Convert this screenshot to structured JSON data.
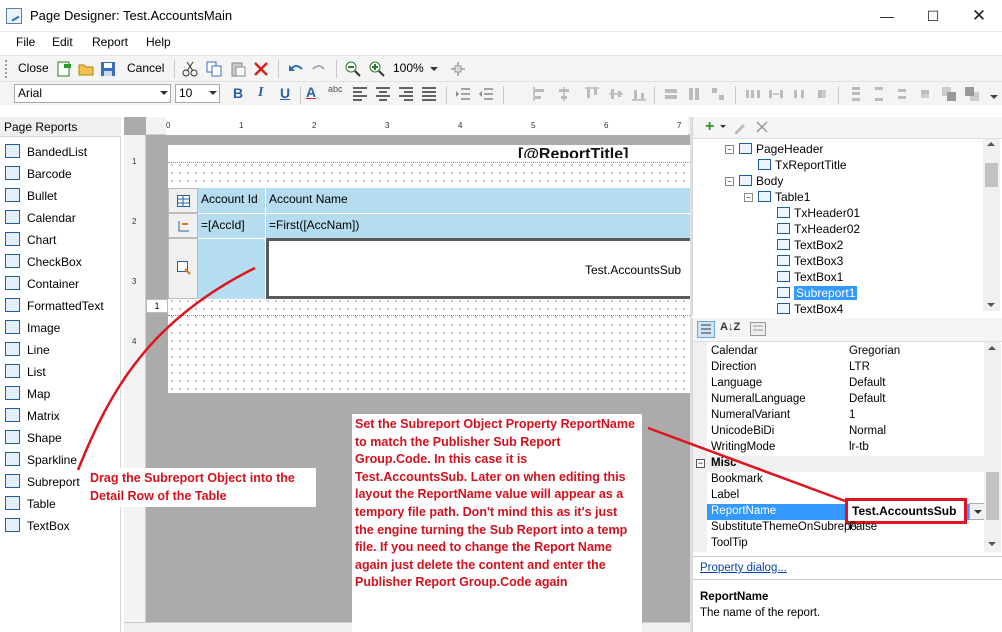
{
  "window": {
    "title": "Page Designer: Test.AccountsMain"
  },
  "menu": [
    "File",
    "Edit",
    "Report",
    "Help"
  ],
  "toolbar1": {
    "close_label": "Close",
    "cancel_label": "Cancel",
    "zoom": "100%"
  },
  "toolbar2": {
    "font": "Arial",
    "size": "10"
  },
  "left_panel": {
    "title": "Page Reports",
    "tools": [
      "BandedList",
      "Barcode",
      "Bullet",
      "Calendar",
      "Chart",
      "CheckBox",
      "Container",
      "FormattedText",
      "Image",
      "Line",
      "List",
      "Map",
      "Matrix",
      "Shape",
      "Sparkline",
      "Subreport",
      "Table",
      "TextBox"
    ]
  },
  "ruler": {
    "ticks": [
      "0",
      "1",
      "2",
      "3",
      "4",
      "5",
      "6",
      "7"
    ],
    "vticks": [
      "1",
      "2",
      "3",
      "4"
    ]
  },
  "design": {
    "header_cells": [
      "Account Id",
      "Account Name"
    ],
    "detail_cells": [
      "=[AccId]",
      "=First([AccNam])"
    ],
    "subreport_label": "Test.AccountsSub",
    "row_marker": "1",
    "partial_title": "[@ReportTitle]"
  },
  "tree": [
    {
      "label": "PageHeader",
      "depth": 0
    },
    {
      "label": "TxReportTitle",
      "depth": 1
    },
    {
      "label": "Body",
      "depth": 0
    },
    {
      "label": "Table1",
      "depth": 1
    },
    {
      "label": "TxHeader01",
      "depth": 2
    },
    {
      "label": "TxHeader02",
      "depth": 2
    },
    {
      "label": "TextBox2",
      "depth": 2
    },
    {
      "label": "TextBox3",
      "depth": 2
    },
    {
      "label": "TextBox1",
      "depth": 2
    },
    {
      "label": "Subreport1",
      "depth": 2,
      "selected": true
    },
    {
      "label": "TextBox4",
      "depth": 2
    }
  ],
  "properties": [
    {
      "name": "Calendar",
      "value": "Gregorian"
    },
    {
      "name": "Direction",
      "value": "LTR"
    },
    {
      "name": "Language",
      "value": "Default"
    },
    {
      "name": "NumeralLanguage",
      "value": "Default"
    },
    {
      "name": "NumeralVariant",
      "value": "1"
    },
    {
      "name": "UnicodeBiDi",
      "value": "Normal"
    },
    {
      "name": "WritingMode",
      "value": "lr-tb"
    }
  ],
  "misc_category": "Misc",
  "misc_properties": [
    {
      "name": "Bookmark",
      "value": ""
    },
    {
      "name": "Label",
      "value": ""
    },
    {
      "name": "ReportName",
      "value": "Test.AccountsSub",
      "selected": true
    },
    {
      "name": "SubstituteThemeOnSubrepo",
      "value": "False"
    },
    {
      "name": "ToolTip",
      "value": ""
    }
  ],
  "property_dialog_link": "Property dialog...",
  "description": {
    "title": "ReportName",
    "text": "The name of the report."
  },
  "annotations": {
    "drag_note": "Drag the Subreport Object into the Detail Row of the Table",
    "set_note": "Set the Subreport Object Property ReportName to match the Publisher Sub Report Group.Code.  In this case it is Test.AccountsSub.  Later on when editing this layout the ReportName value will appear as a tempory file path.  Don't mind this as it's just the engine turning the Sub Report into a temp file.  If you need to change the Report Name again just delete the content and enter the Publisher Report Group.Code again"
  },
  "colors": {
    "accent": "#d4111d",
    "header_cell": "#b6dcf0",
    "selection": "#3399ff"
  }
}
